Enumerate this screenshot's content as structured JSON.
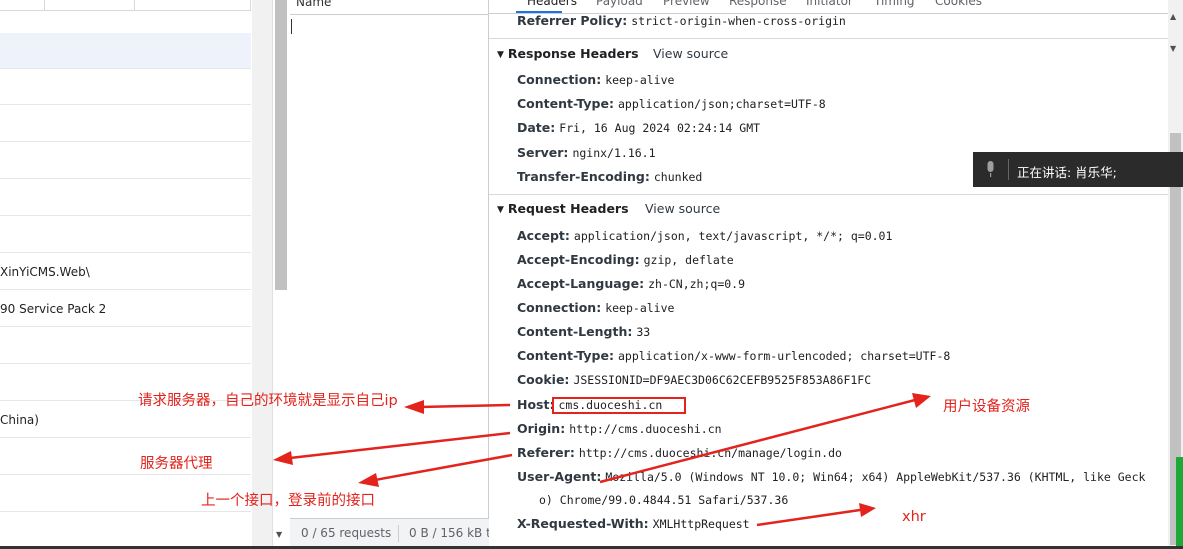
{
  "left_pane": {
    "rows": [
      "",
      "",
      "",
      "",
      "",
      "",
      "XinYiCMS.Web\\",
      "90 Service Pack 2",
      "",
      "",
      "China)",
      "",
      "",
      ""
    ]
  },
  "name_column": {
    "header": "Name",
    "status": {
      "requests": "0 / 65 requests",
      "size": "0 B / 156 kB t"
    }
  },
  "tabs": [
    "Headers",
    "Payload",
    "Preview",
    "Response",
    "Initiator",
    "Timing",
    "Cookies"
  ],
  "general": {
    "rows": [
      {
        "key": "Referrer Policy:",
        "value": "strict-origin-when-cross-origin"
      }
    ]
  },
  "response_headers": {
    "title": "Response Headers",
    "view_source": "View source",
    "rows": [
      {
        "key": "Connection:",
        "value": "keep-alive"
      },
      {
        "key": "Content-Type:",
        "value": "application/json;charset=UTF-8"
      },
      {
        "key": "Date:",
        "value": "Fri, 16 Aug 2024 02:24:14 GMT"
      },
      {
        "key": "Server:",
        "value": "nginx/1.16.1"
      },
      {
        "key": "Transfer-Encoding:",
        "value": "chunked"
      }
    ]
  },
  "request_headers": {
    "title": "Request Headers",
    "view_source": "View source",
    "rows": [
      {
        "key": "Accept:",
        "value": "application/json, text/javascript, */*; q=0.01"
      },
      {
        "key": "Accept-Encoding:",
        "value": "gzip, deflate"
      },
      {
        "key": "Accept-Language:",
        "value": "zh-CN,zh;q=0.9"
      },
      {
        "key": "Connection:",
        "value": "keep-alive"
      },
      {
        "key": "Content-Length:",
        "value": "33"
      },
      {
        "key": "Content-Type:",
        "value": "application/x-www-form-urlencoded; charset=UTF-8"
      },
      {
        "key": "Cookie:",
        "value": "JSESSIONID=DF9AEC3D06C62CEFB9525F853A86F1FC"
      },
      {
        "key": "Host:",
        "value": "cms.duoceshi.cn"
      },
      {
        "key": "Origin:",
        "value": "http://cms.duoceshi.cn"
      },
      {
        "key": "Referer:",
        "value": "http://cms.duoceshi.cn/manage/login.do"
      },
      {
        "key": "User-Agent:",
        "value": "Mozilla/5.0 (Windows NT 10.0; Win64; x64) AppleWebKit/537.36 (KHTML, like Geck"
      },
      {
        "key": "X-Requested-With:",
        "value": "XMLHttpRequest"
      }
    ],
    "user_agent_cont": "o) Chrome/99.0.4844.51 Safari/537.36"
  },
  "voice_overlay": {
    "text": "正在讲话:  肖乐华;",
    "icon": "microphone-icon"
  },
  "annotations": {
    "host_note": "请求服务器，自己的环境就是显示自己ip",
    "origin_note": "服务器代理",
    "referer_note": "上一个接口，登录前的接口",
    "ua_note": "用户设备资源",
    "xhr_note": "xhr"
  },
  "colors": {
    "annotation": "#e3231c",
    "active_tab": "#1a73e8",
    "scrollbar_accent": "#1ea838"
  }
}
